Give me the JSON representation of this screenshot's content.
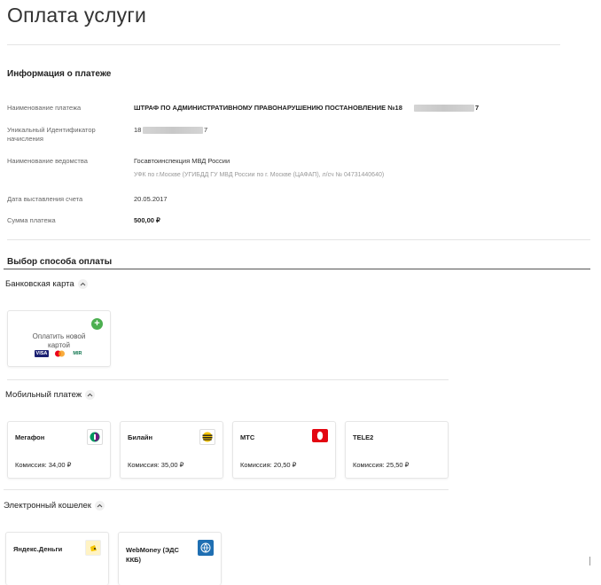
{
  "page": {
    "title": "Оплата услуги"
  },
  "info": {
    "heading": "Информация о платеже",
    "rows": [
      {
        "label": "Наименование платежа",
        "value": "ШТРАФ ПО АДМИНИСТРАТИВНОМУ ПРАВОНАРУШЕНИЮ ПОСТАНОВЛЕНИЕ №18",
        "value_suffix": "7"
      },
      {
        "label_line1": "Уникальный Идентификатор",
        "label_line2": "начисления",
        "value": "18",
        "value_suffix": "7"
      },
      {
        "label": "Наименование ведомства",
        "value": "Госавтоинспекция МВД России",
        "sub": "УФК по г.Москве (УГИБДД ГУ МВД России по г. Москве (ЦАФАП), л/сч № 04731440640)"
      },
      {
        "label": "Дата выставления счета",
        "value": "20.05.2017"
      },
      {
        "label": "Сумма платежа",
        "value": "500,00 ₽"
      }
    ]
  },
  "payment": {
    "heading": "Выбор способа оплаты",
    "bank_card": {
      "title": "Банковская карта",
      "new_card_line1": "Оплатить новой",
      "new_card_line2": "картой",
      "logos": [
        "VISA",
        "MIR"
      ]
    },
    "mobile": {
      "title": "Мобильный платеж",
      "operators": [
        {
          "name": "Мегафон",
          "fee": "Комиссия: 34,00 ₽",
          "icon": "megafon-icon"
        },
        {
          "name": "Билайн",
          "fee": "Комиссия: 35,00 ₽",
          "icon": "beeline-icon"
        },
        {
          "name": "МТС",
          "fee": "Комиссия: 20,50 ₽",
          "icon": "mts-icon"
        },
        {
          "name": "TELE2",
          "fee": "Комиссия: 25,50 ₽",
          "icon": ""
        }
      ]
    },
    "wallet": {
      "title": "Электронный кошелек",
      "items": [
        {
          "name": "Яндекс.Деньги",
          "icon": "yandex-money-icon"
        },
        {
          "name_line1": "WebMoney (ЭДС",
          "name_line2": "ККБ)",
          "icon": "webmoney-icon"
        }
      ]
    }
  },
  "colors": {
    "accent_green": "#4caf50",
    "mts_red": "#e30611",
    "beeline_yellow": "#f5c400"
  }
}
